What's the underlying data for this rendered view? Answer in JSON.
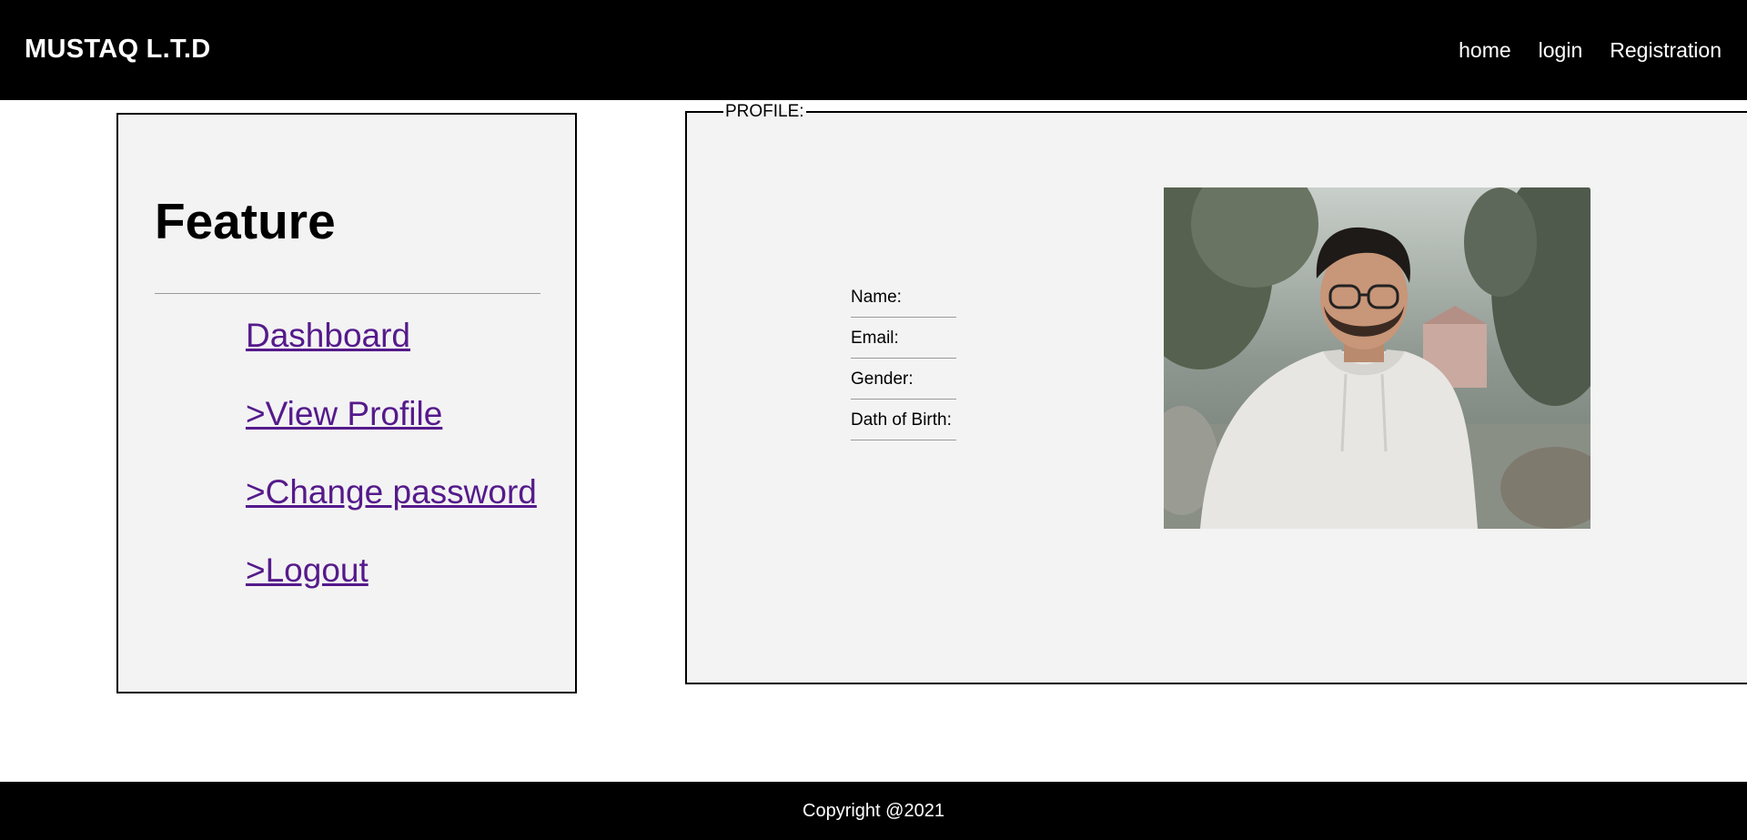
{
  "header": {
    "brand": "MUSTAQ L.T.D",
    "nav": [
      {
        "label": "home"
      },
      {
        "label": "login"
      },
      {
        "label": "Registration"
      }
    ]
  },
  "sidebar": {
    "title": "Feature",
    "links": [
      {
        "label": "Dashboard"
      },
      {
        "label": ">View Profile"
      },
      {
        "label": ">Change password"
      },
      {
        "label": ">Logout"
      }
    ]
  },
  "profile": {
    "legend": "PROFILE:",
    "fields": [
      {
        "label": "Name:"
      },
      {
        "label": "Email:"
      },
      {
        "label": "Gender:"
      },
      {
        "label": "Dath of Birth:"
      }
    ]
  },
  "footer": {
    "text": "Copyright @2021"
  },
  "colors": {
    "header_bg": "#000000",
    "panel_bg": "#f3f3f3",
    "link_visited": "#551a8b"
  }
}
